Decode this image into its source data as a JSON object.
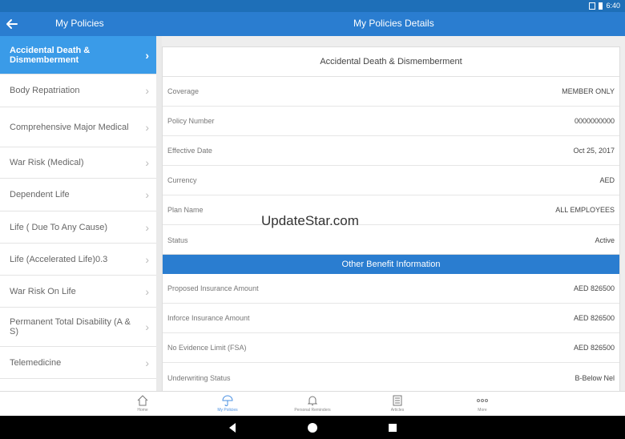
{
  "status_bar": {
    "time": "6:40"
  },
  "app_bar": {
    "left_title": "My Policies",
    "right_title": "My Policies Details"
  },
  "sidebar": {
    "items": [
      {
        "label": "Accidental Death & Dismemberment",
        "active": true
      },
      {
        "label": "Body Repatriation"
      },
      {
        "label": "Comprehensive Major Medical"
      },
      {
        "label": "War Risk (Medical)"
      },
      {
        "label": "Dependent Life"
      },
      {
        "label": "Life ( Due To Any Cause)"
      },
      {
        "label": "Life (Accelerated Life)0.3"
      },
      {
        "label": "War Risk On Life"
      },
      {
        "label": "Permanent Total Disability (A & S)"
      },
      {
        "label": "Telemedicine"
      }
    ]
  },
  "policy_card": {
    "title": "Accidental Death & Dismemberment",
    "rows": [
      {
        "label": "Coverage",
        "value": "MEMBER ONLY"
      },
      {
        "label": "Policy Number",
        "value": "0000000000"
      },
      {
        "label": "Effective Date",
        "value": "Oct 25, 2017"
      },
      {
        "label": "Currency",
        "value": "AED"
      },
      {
        "label": "Plan Name",
        "value": "ALL EMPLOYEES"
      },
      {
        "label": "Status",
        "value": "Active"
      }
    ]
  },
  "benefit_card": {
    "title": "Other Benefit Information",
    "rows": [
      {
        "label": "Proposed Insurance Amount",
        "value": "AED 826500"
      },
      {
        "label": "Inforce Insurance Amount",
        "value": "AED 826500"
      },
      {
        "label": "No Evidence Limit (FSA)",
        "value": "AED 826500"
      },
      {
        "label": "Underwriting Status",
        "value": "B-Below Nel"
      }
    ]
  },
  "watermark": "UpdateStar.com",
  "bottom_nav": {
    "home": "Home",
    "my_policies": "My Policies",
    "reminders": "Personal Reminders",
    "articles": "Articles",
    "more": "More"
  },
  "colors": {
    "primary": "#2a7dd0",
    "active_item": "#3a9be8",
    "status_bar": "#1e6fb8"
  }
}
